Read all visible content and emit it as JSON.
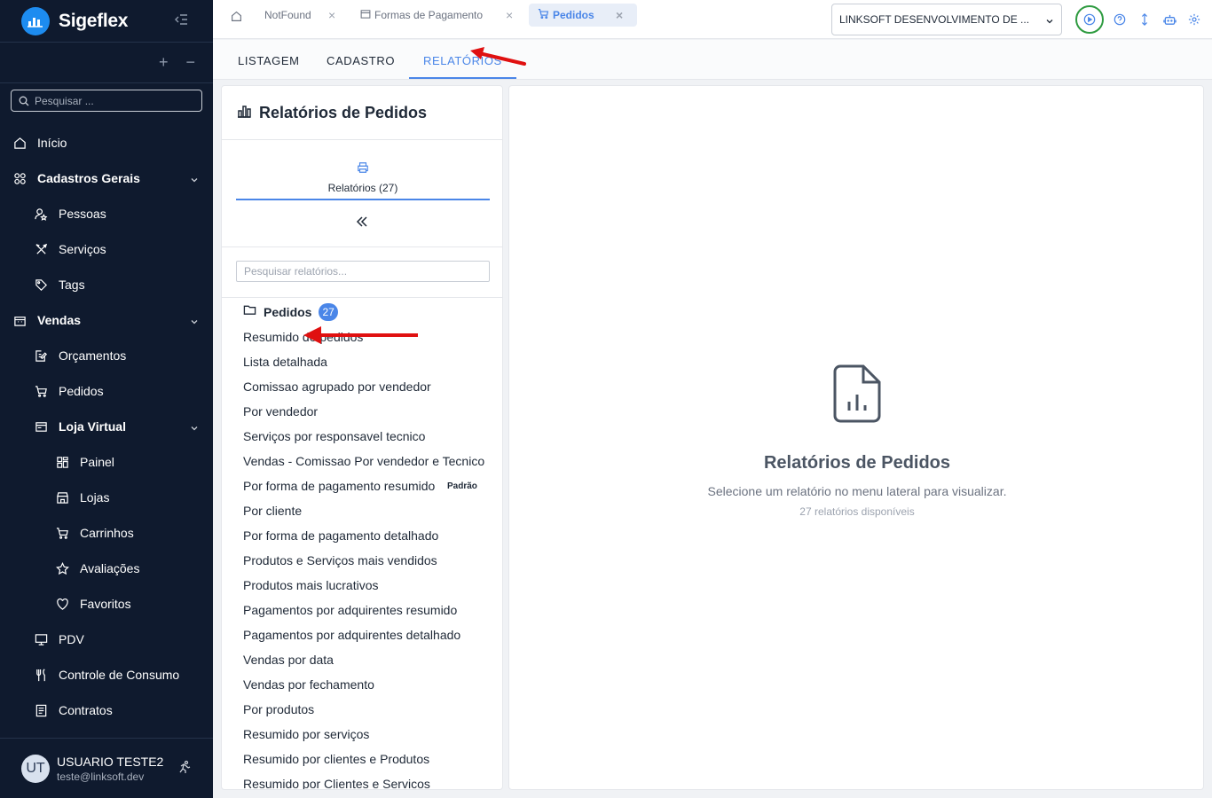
{
  "sidebar": {
    "brand": "Sigeflex",
    "search_placeholder": "Pesquisar ...",
    "items": [
      {
        "label": "Início",
        "icon": "home-icon"
      },
      {
        "label": "Cadastros Gerais",
        "icon": "grid-icon"
      },
      {
        "label": "Pessoas",
        "icon": "user-star-icon"
      },
      {
        "label": "Serviços",
        "icon": "tools-icon"
      },
      {
        "label": "Tags",
        "icon": "tag-icon"
      },
      {
        "label": "Vendas",
        "icon": "bag-icon"
      },
      {
        "label": "Orçamentos",
        "icon": "edit-doc-icon"
      },
      {
        "label": "Pedidos",
        "icon": "cart-icon"
      },
      {
        "label": "Loja Virtual",
        "icon": "store-card-icon"
      },
      {
        "label": "Painel",
        "icon": "dashboard-icon"
      },
      {
        "label": "Lojas",
        "icon": "shop-icon"
      },
      {
        "label": "Carrinhos",
        "icon": "cart-icon"
      },
      {
        "label": "Avaliações",
        "icon": "star-icon"
      },
      {
        "label": "Favoritos",
        "icon": "heart-icon"
      },
      {
        "label": "PDV",
        "icon": "monitor-icon"
      },
      {
        "label": "Controle de Consumo",
        "icon": "utensils-icon"
      },
      {
        "label": "Contratos",
        "icon": "document-icon"
      }
    ],
    "user": {
      "initials": "UT",
      "name": "USUARIO TESTE2",
      "email": "teste@linksoft.dev"
    }
  },
  "topbar": {
    "tabs": [
      {
        "label": "NotFound"
      },
      {
        "label": "Formas de Pagamento"
      },
      {
        "label": "Pedidos"
      }
    ],
    "company": "LINKSOFT DESENVOLVIMENTO DE ...",
    "accent": "#4a86e8",
    "highlight_ring": "#2e9b40"
  },
  "subtabs": [
    "LISTAGEM",
    "CADASTRO",
    "RELATÓRIOS"
  ],
  "reports_panel": {
    "title": "Relatórios de Pedidos",
    "tab_label": "Relatórios (27)",
    "search_placeholder": "Pesquisar relatórios...",
    "folder": {
      "label": "Pedidos",
      "count": "27"
    },
    "items": [
      {
        "label": "Resumido de pedidos"
      },
      {
        "label": "Lista detalhada"
      },
      {
        "label": "Comissao agrupado por vendedor"
      },
      {
        "label": "Por vendedor"
      },
      {
        "label": "Serviços por responsavel tecnico"
      },
      {
        "label": "Vendas - Comissao Por vendedor e Tecnico"
      },
      {
        "label": "Por forma de pagamento resumido",
        "tag": "Padrão"
      },
      {
        "label": "Por cliente"
      },
      {
        "label": "Por forma de pagamento detalhado"
      },
      {
        "label": "Produtos e Serviços mais vendidos"
      },
      {
        "label": "Produtos mais lucrativos"
      },
      {
        "label": "Pagamentos por adquirentes resumido"
      },
      {
        "label": "Pagamentos por adquirentes detalhado"
      },
      {
        "label": "Vendas por data"
      },
      {
        "label": "Vendas por fechamento"
      },
      {
        "label": "Por produtos"
      },
      {
        "label": "Resumido por serviços"
      },
      {
        "label": "Resumido por clientes e Produtos"
      },
      {
        "label": "Resumido por Clientes e Servicos"
      }
    ]
  },
  "empty_state": {
    "title": "Relatórios de Pedidos",
    "subtitle": "Selecione um relatório no menu lateral para visualizar.",
    "count_text": "27 relatórios disponíveis"
  },
  "annotation_color": "#e01010"
}
